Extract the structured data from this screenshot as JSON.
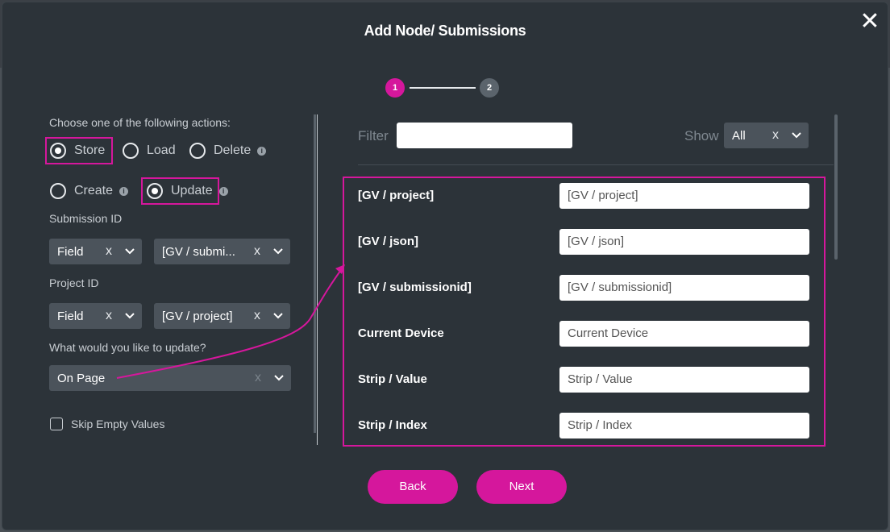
{
  "modal": {
    "title": "Add Node/ Submissions",
    "close_glyph": "✕"
  },
  "stepper": {
    "step1": "1",
    "step2": "2",
    "active": 1
  },
  "left": {
    "choose_label": "Choose one of the following actions:",
    "radios": [
      {
        "label": "Store",
        "checked": true,
        "info": false
      },
      {
        "label": "Load",
        "checked": false,
        "info": false
      },
      {
        "label": "Delete",
        "checked": false,
        "info": true
      },
      {
        "label": "Create",
        "checked": false,
        "info": true
      },
      {
        "label": "Update",
        "checked": true,
        "info": true
      }
    ],
    "info_glyph": "i",
    "submission_id": {
      "label": "Submission ID",
      "type_value": "Field",
      "field_value": "[GV / submi..."
    },
    "project_id": {
      "label": "Project ID",
      "type_value": "Field",
      "field_value": "[GV / project]"
    },
    "update": {
      "label": "What would you like to update?",
      "value": "On Page"
    },
    "skip_empty": {
      "label": "Skip Empty Values",
      "checked": false
    },
    "clear_glyph": "x"
  },
  "right": {
    "filter_label": "Filter",
    "filter_value": "",
    "show_label": "Show",
    "show_value": "All",
    "rows": [
      {
        "label": "[GV / project]",
        "value": "[GV / project]"
      },
      {
        "label": "[GV / json]",
        "value": "[GV / json]"
      },
      {
        "label": "[GV / submissionid]",
        "value": "[GV / submissionid]"
      },
      {
        "label": "Current Device",
        "value": "Current Device"
      },
      {
        "label": "Strip / Value",
        "value": "Strip / Value"
      },
      {
        "label": "Strip / Index",
        "value": "Strip / Index"
      }
    ]
  },
  "footer": {
    "back_label": "Back",
    "next_label": "Next"
  },
  "colors": {
    "accent": "#d5179c",
    "panel": "#2c3339",
    "select_bg": "#4b535b"
  }
}
